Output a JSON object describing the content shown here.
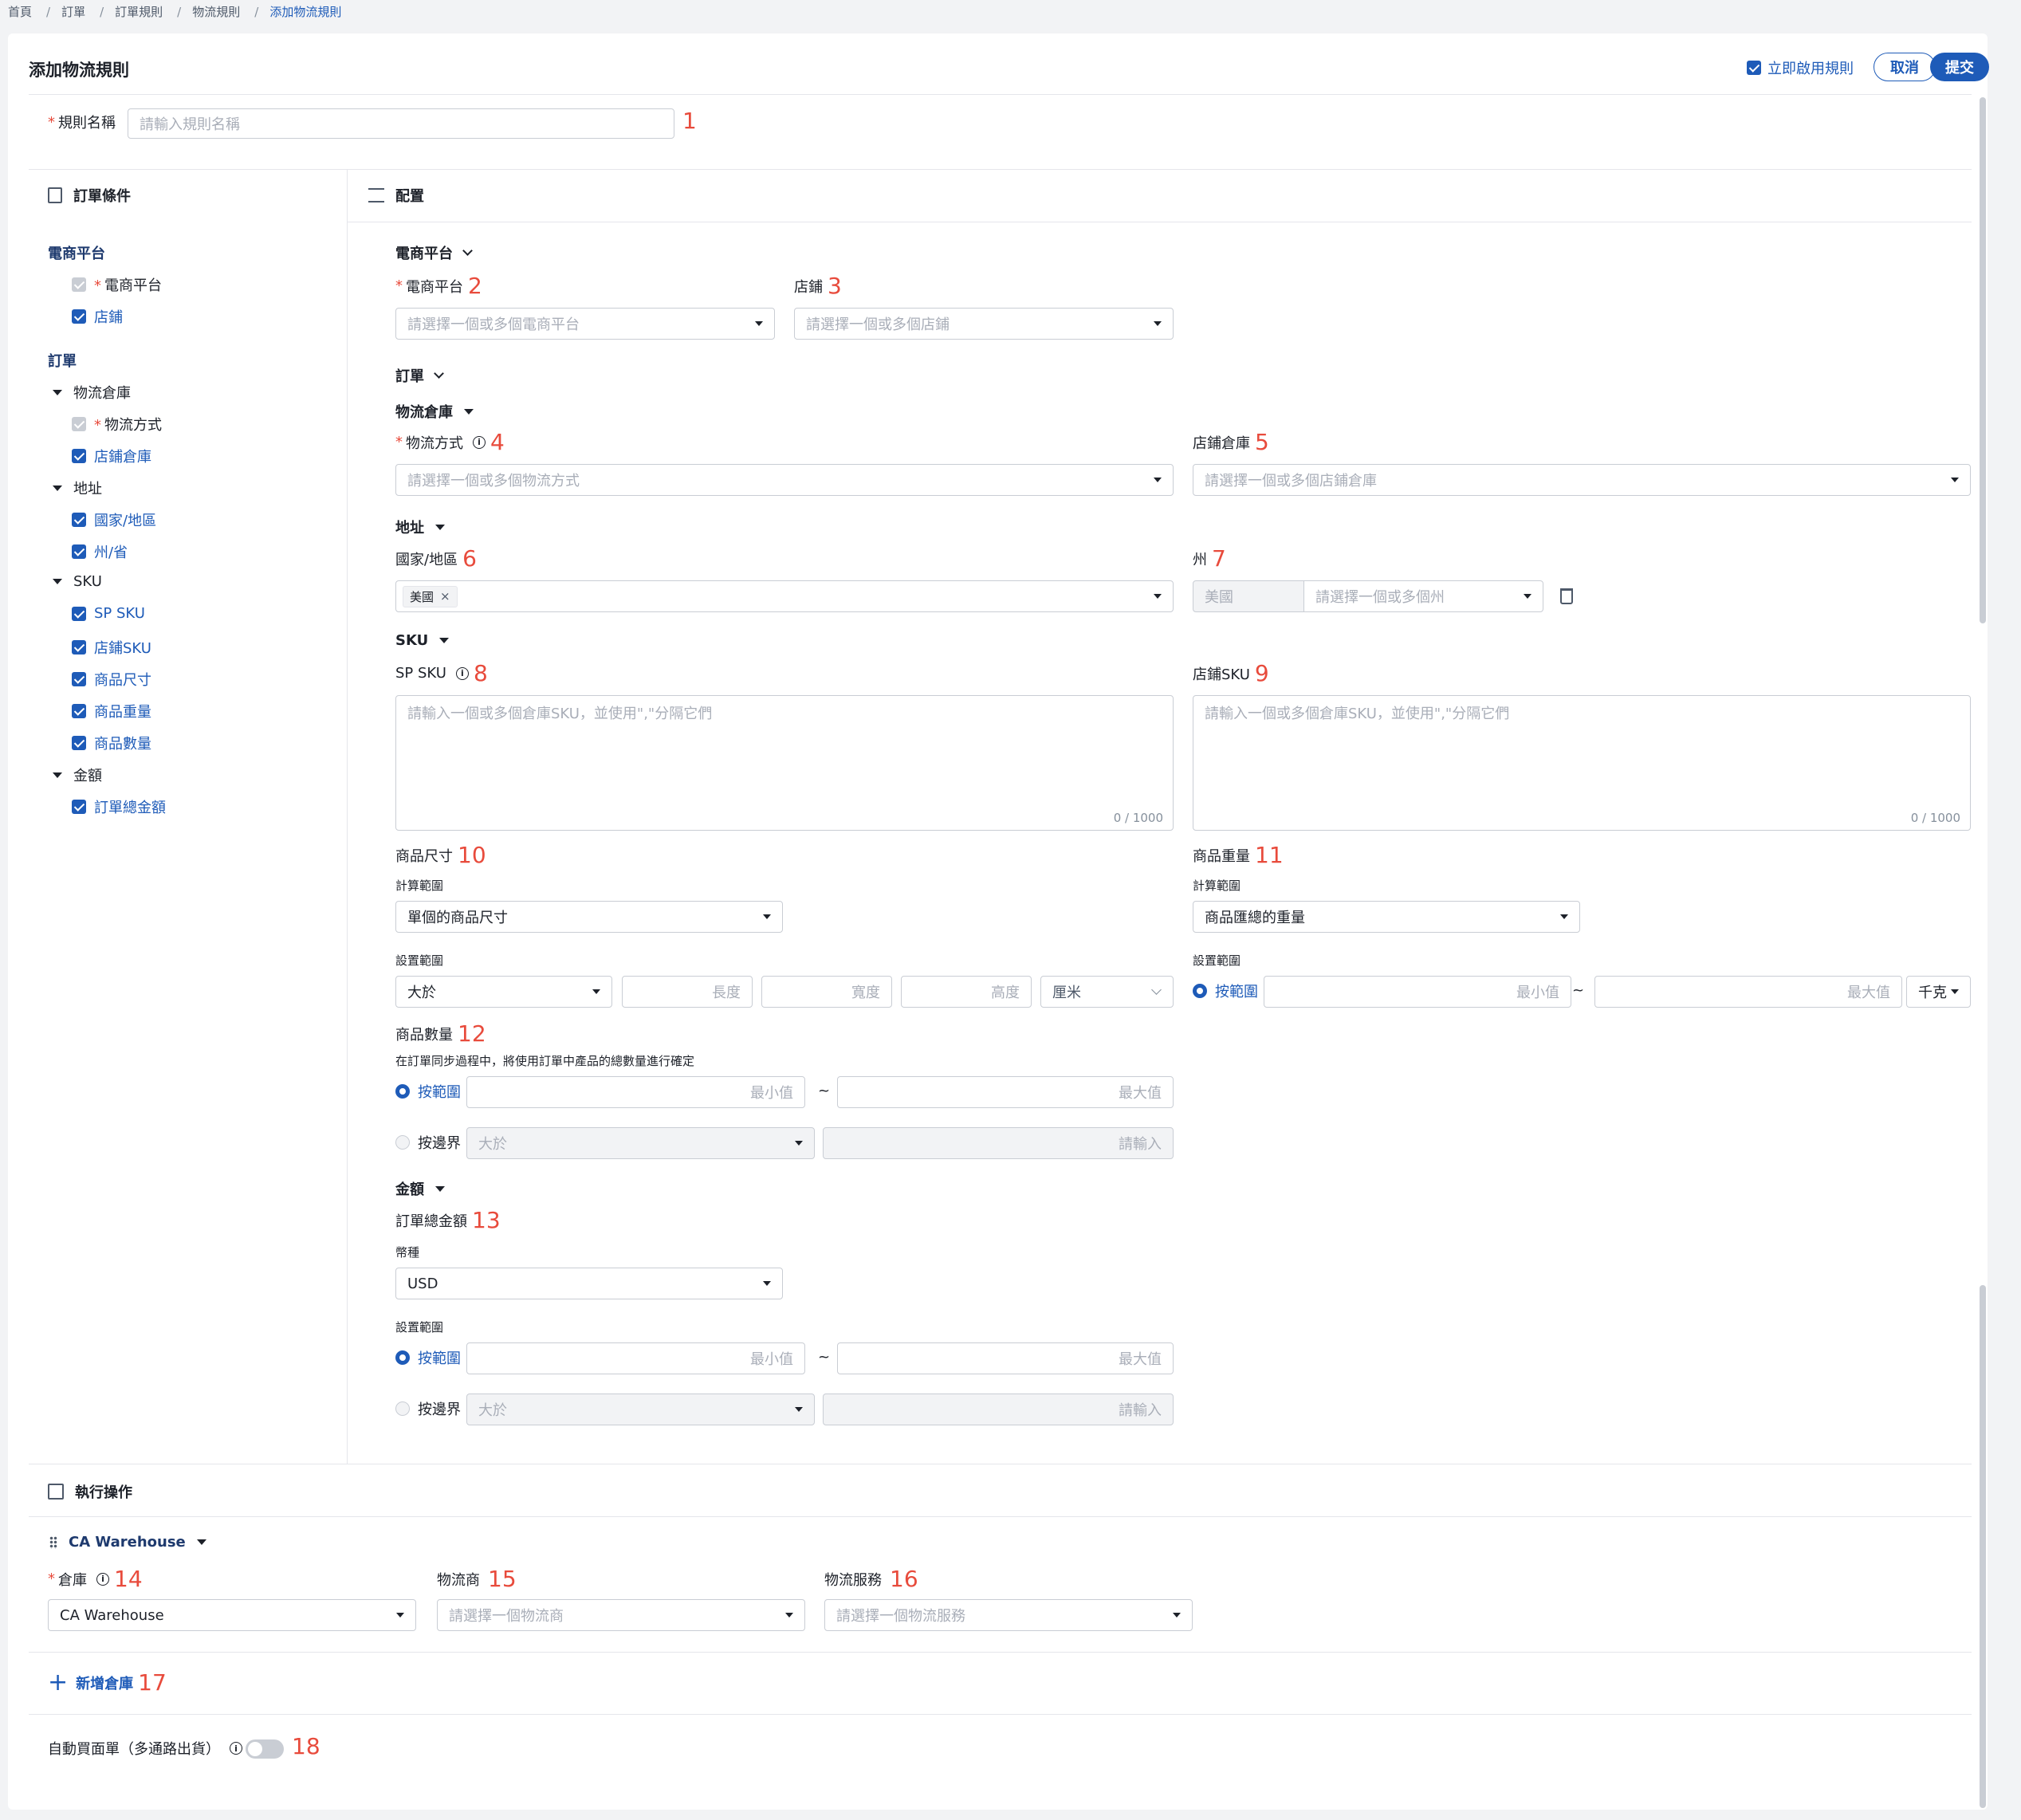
{
  "breadcrumb": {
    "home": "首頁",
    "orders": "訂單",
    "order_rules": "訂單規則",
    "logistics_rules": "物流規則",
    "current": "添加物流規則"
  },
  "header": {
    "title": "添加物流規則",
    "enable_now": "立即啟用規則",
    "cancel": "取消",
    "submit": "提交"
  },
  "rule_name": {
    "label": "規則名稱",
    "placeholder": "請輸入規則名稱",
    "num": "1"
  },
  "left": {
    "title": "訂單條件",
    "platform_section": "電商平台",
    "platform_items": [
      "電商平台",
      "店鋪"
    ],
    "order_section": "訂單",
    "groups": {
      "warehouse": "物流倉庫",
      "address": "地址",
      "sku": "SKU",
      "amount": "金額"
    },
    "warehouse_items": [
      "物流方式",
      "店鋪倉庫"
    ],
    "address_items": [
      "國家/地區",
      "州/省"
    ],
    "sku_items": [
      "SP SKU",
      "店鋪SKU",
      "商品尺寸",
      "商品重量",
      "商品數量"
    ],
    "amount_items": [
      "訂單總金額"
    ]
  },
  "config": {
    "title": "配置",
    "platform_section": "電商平台",
    "platform": {
      "label": "電商平台",
      "num": "2",
      "placeholder": "請選擇一個或多個電商平台"
    },
    "shop": {
      "label": "店鋪",
      "num": "3",
      "placeholder": "請選擇一個或多個店鋪"
    },
    "order_section": "訂單",
    "warehouse_section": "物流倉庫",
    "ship_method": {
      "label": "物流方式",
      "num": "4",
      "placeholder": "請選擇一個或多個物流方式"
    },
    "shop_wh": {
      "label": "店鋪倉庫",
      "num": "5",
      "placeholder": "請選擇一個或多個店鋪倉庫"
    },
    "address_section": "地址",
    "country": {
      "label": "國家/地區",
      "num": "6",
      "tag": "美國"
    },
    "state": {
      "label": "州",
      "num": "7",
      "prefix": "美國",
      "placeholder": "請選擇一個或多個州"
    },
    "sku_section": "SKU",
    "sp_sku": {
      "label": "SP SKU",
      "num": "8",
      "placeholder": "請輸入一個或多個倉庫SKU，並使用\",\"分隔它們",
      "count": "0 / 1000"
    },
    "shop_sku": {
      "label": "店鋪SKU",
      "num": "9",
      "placeholder": "請輸入一個或多個倉庫SKU，並使用\",\"分隔它們",
      "count": "0 / 1000"
    },
    "size": {
      "label": "商品尺寸",
      "num": "10",
      "calc_label": "計算範圍",
      "calc_value": "單個的商品尺寸",
      "range_label": "設置範圍",
      "op": "大於",
      "len": "長度",
      "wid": "寬度",
      "hei": "高度",
      "unit": "厘米"
    },
    "weight": {
      "label": "商品重量",
      "num": "11",
      "calc_label": "計算範圍",
      "calc_value": "商品匯總的重量",
      "range_label": "設置範圍",
      "by_range": "按範圍",
      "min": "最小值",
      "max": "最大值",
      "unit": "千克"
    },
    "qty": {
      "label": "商品數量",
      "num": "12",
      "desc": "在訂單同步過程中，將使用訂單中產品的總數量進行確定",
      "by_range": "按範圍",
      "min": "最小值",
      "max": "最大值",
      "by_bound": "按邊界",
      "op": "大於",
      "input": "請輸入"
    },
    "amount_section": "金額",
    "amount": {
      "label": "訂單總金額",
      "num": "13",
      "currency_label": "幣種",
      "currency": "USD",
      "range_label": "設置範圍",
      "by_range": "按範圍",
      "min": "最小值",
      "max": "最大值",
      "by_bound": "按邊界",
      "op": "大於",
      "input": "請輸入"
    }
  },
  "exec": {
    "title": "執行操作",
    "warehouse_group": "CA Warehouse",
    "wh": {
      "label": "倉庫",
      "num": "14",
      "value": "CA Warehouse"
    },
    "carrier": {
      "label": "物流商",
      "num": "15",
      "placeholder": "請選擇一個物流商"
    },
    "service": {
      "label": "物流服務",
      "num": "16",
      "placeholder": "請選擇一個物流服務"
    },
    "add_wh": "新增倉庫",
    "add_num": "17",
    "auto_label": "自動買面單（多通路出貨）",
    "auto_num": "18"
  },
  "tilde": "~",
  "colors": {
    "accent": "#1e5bb8",
    "required": "#e84b3c"
  }
}
